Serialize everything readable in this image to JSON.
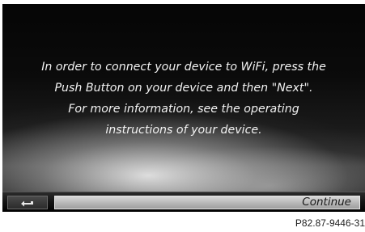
{
  "message": {
    "lines": [
      "In order to connect your device to WiFi, press the",
      "Push Button on your device and then \"Next\".",
      "For more information, see the operating",
      "instructions of your device."
    ]
  },
  "bottom_bar": {
    "back_icon": "back-arrow-icon",
    "continue_label": "Continue"
  },
  "caption": {
    "figure_id": "P82.87-9446-31"
  },
  "colors": {
    "screen_background": "#0b0b0b",
    "message_text": "#f2f2f2",
    "continue_button": "#bdbdbd"
  }
}
